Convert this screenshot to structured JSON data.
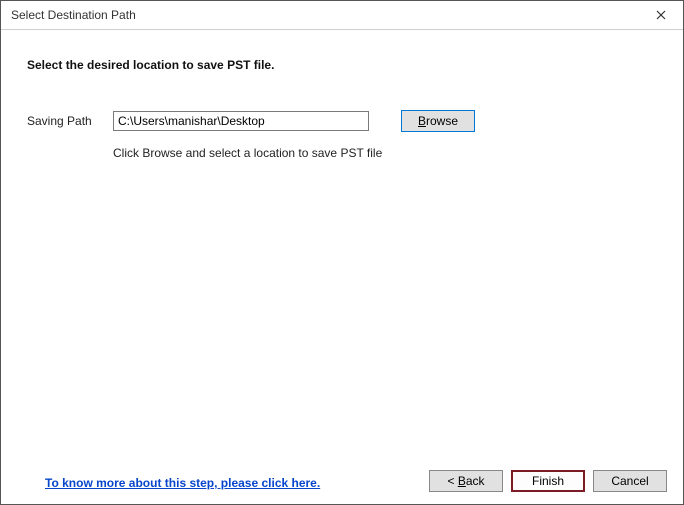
{
  "title": "Select Destination Path",
  "heading": "Select the desired location to save PST file.",
  "saving_path_label": "Saving Path",
  "saving_path_value": "C:\\Users\\manishar\\Desktop",
  "browse": {
    "u": "B",
    "rest": "rowse"
  },
  "hint": "Click Browse and select a location to save PST file",
  "help_link": "To know more about this step, please click here.",
  "buttons": {
    "back": {
      "prefix": "< ",
      "u": "B",
      "rest": "ack"
    },
    "finish": "Finish",
    "cancel": "Cancel"
  }
}
